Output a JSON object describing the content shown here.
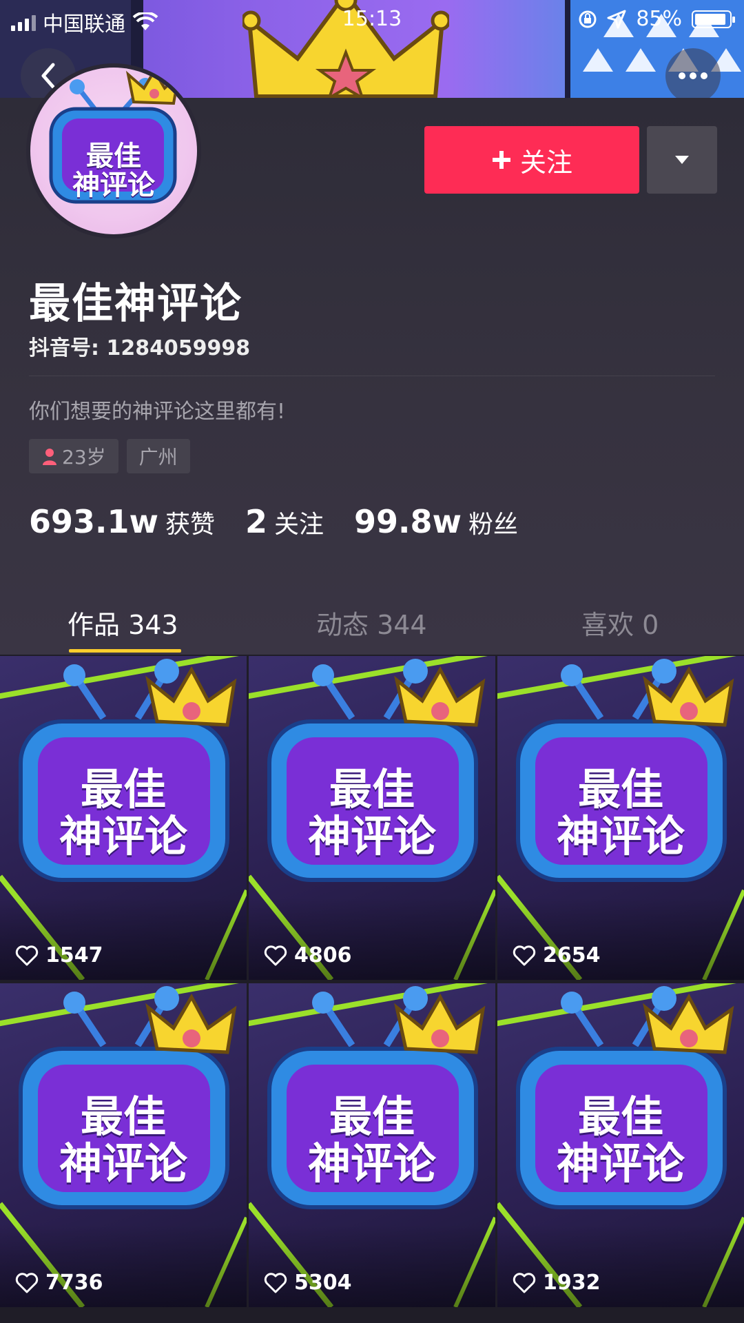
{
  "status_bar": {
    "carrier": "中国联通",
    "time": "15:13",
    "battery": "85%"
  },
  "profile": {
    "avatar_text_line1": "最佳",
    "avatar_text_line2": "神评论",
    "follow_label": "关注",
    "name": "最佳神评论",
    "uid": "抖音号: 1284059998",
    "bio": "你们想要的神评论这里都有!",
    "tags": [
      {
        "label": "23岁",
        "icon": "female-icon"
      },
      {
        "label": "广州"
      }
    ],
    "stats": [
      {
        "value": "693.1w",
        "label": "获赞"
      },
      {
        "value": "2",
        "label": "关注"
      },
      {
        "value": "99.8w",
        "label": "粉丝"
      }
    ]
  },
  "tabs": [
    {
      "label": "作品 343",
      "active": true
    },
    {
      "label": "动态 344",
      "active": false
    },
    {
      "label": "喜欢 0",
      "active": false
    }
  ],
  "videos": [
    {
      "likes": "1547",
      "title_line1": "最佳",
      "title_line2": "神评论"
    },
    {
      "likes": "4806",
      "title_line1": "最佳",
      "title_line2": "神评论"
    },
    {
      "likes": "2654",
      "title_line1": "最佳",
      "title_line2": "神评论"
    },
    {
      "likes": "7736",
      "title_line1": "最佳",
      "title_line2": "神评论"
    },
    {
      "likes": "5304",
      "title_line1": "最佳",
      "title_line2": "神评论"
    },
    {
      "likes": "1932",
      "title_line1": "最佳",
      "title_line2": "神评论"
    }
  ],
  "colors": {
    "follow_button": "#fe2c55",
    "tab_underline": "#facd2c",
    "background": "#2a2833"
  }
}
